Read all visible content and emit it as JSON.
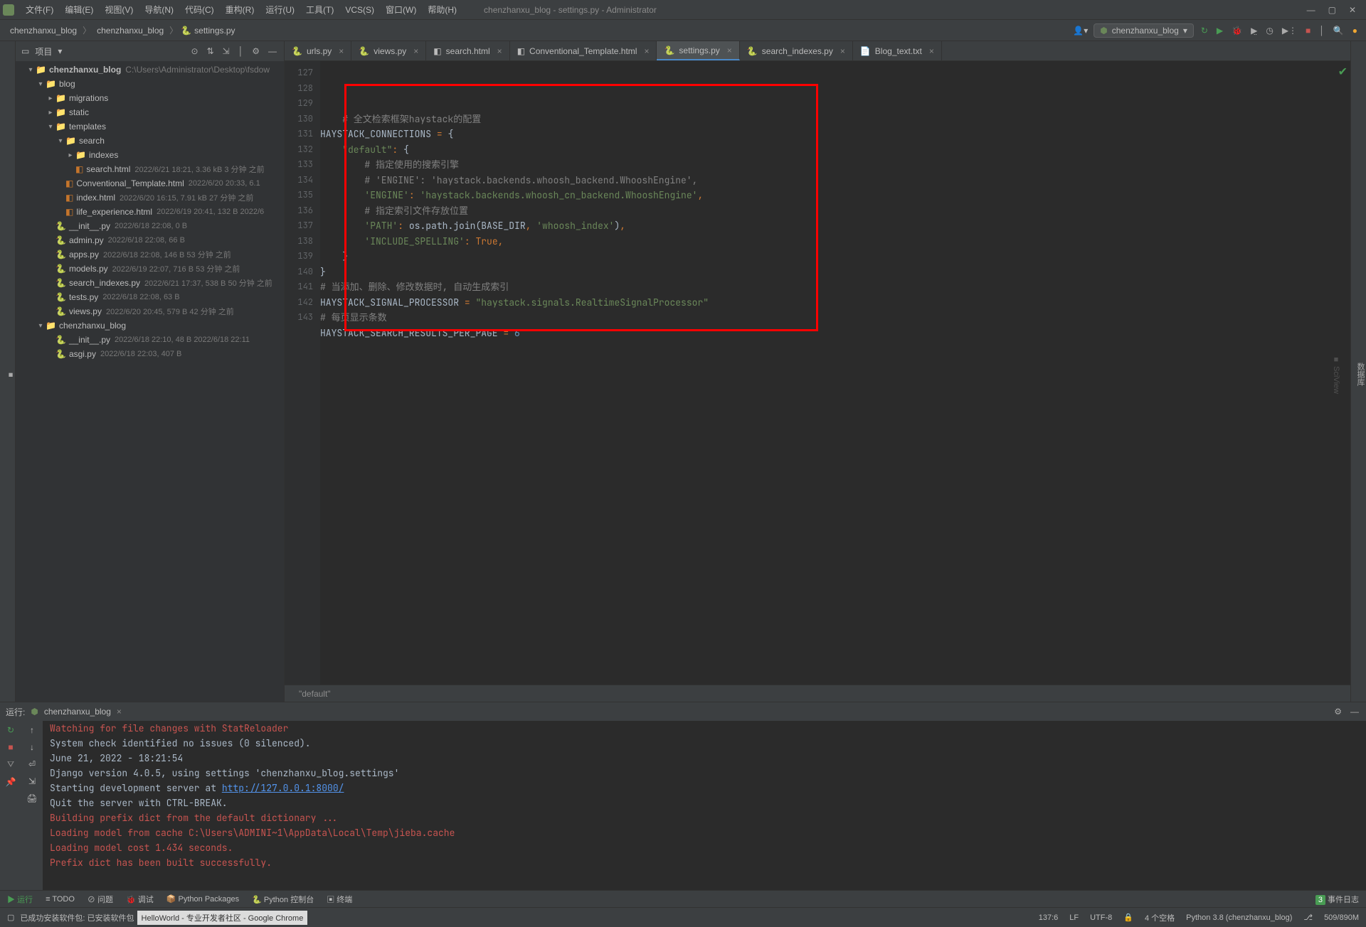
{
  "window": {
    "title": "chenzhanxu_blog - settings.py - Administrator"
  },
  "menubar": {
    "file": "文件(F)",
    "edit": "编辑(E)",
    "view": "视图(V)",
    "nav": "导航(N)",
    "code": "代码(C)",
    "refactor": "重构(R)",
    "run": "运行(U)",
    "tools": "工具(T)",
    "vcs": "VCS(S)",
    "window": "窗口(W)",
    "help": "帮助(H)"
  },
  "breadcrumbs": {
    "a": "chenzhanxu_blog",
    "b": "chenzhanxu_blog",
    "c": "settings.py"
  },
  "config": {
    "name": "chenzhanxu_blog"
  },
  "project": {
    "title": "项目",
    "root": "chenzhanxu_blog",
    "rootpath": "C:\\Users\\Administrator\\Desktop\\fsdow",
    "items": [
      {
        "i": 2,
        "caret": "▾",
        "icon": "F",
        "name": "blog"
      },
      {
        "i": 3,
        "caret": "▸",
        "icon": "F",
        "name": "migrations"
      },
      {
        "i": 3,
        "caret": "▸",
        "icon": "F",
        "name": "static"
      },
      {
        "i": 3,
        "caret": "▾",
        "icon": "F",
        "name": "templates"
      },
      {
        "i": 4,
        "caret": "▾",
        "icon": "F",
        "name": "search"
      },
      {
        "i": 5,
        "caret": "▸",
        "icon": "F",
        "name": "indexes"
      },
      {
        "i": 5,
        "caret": "",
        "icon": "H",
        "name": "search.html",
        "meta": "2022/6/21 18:21, 3.36 kB 3 分钟 之前"
      },
      {
        "i": 4,
        "caret": "",
        "icon": "H",
        "name": "Conventional_Template.html",
        "meta": "2022/6/20 20:33, 6.1"
      },
      {
        "i": 4,
        "caret": "",
        "icon": "H",
        "name": "index.html",
        "meta": "2022/6/20 16:15, 7.91 kB 27 分钟 之前"
      },
      {
        "i": 4,
        "caret": "",
        "icon": "H",
        "name": "life_experience.html",
        "meta": "2022/6/19 20:41, 132 B 2022/6"
      },
      {
        "i": 3,
        "caret": "",
        "icon": "P",
        "name": "__init__.py",
        "meta": "2022/6/18 22:08, 0 B"
      },
      {
        "i": 3,
        "caret": "",
        "icon": "P",
        "name": "admin.py",
        "meta": "2022/6/18 22:08, 66 B"
      },
      {
        "i": 3,
        "caret": "",
        "icon": "P",
        "name": "apps.py",
        "meta": "2022/6/18 22:08, 146 B 53 分钟 之前"
      },
      {
        "i": 3,
        "caret": "",
        "icon": "P",
        "name": "models.py",
        "meta": "2022/6/19 22:07, 716 B 53 分钟 之前"
      },
      {
        "i": 3,
        "caret": "",
        "icon": "P",
        "name": "search_indexes.py",
        "meta": "2022/6/21 17:37, 538 B 50 分钟 之前"
      },
      {
        "i": 3,
        "caret": "",
        "icon": "P",
        "name": "tests.py",
        "meta": "2022/6/18 22:08, 63 B"
      },
      {
        "i": 3,
        "caret": "",
        "icon": "P",
        "name": "views.py",
        "meta": "2022/6/20 20:45, 579 B 42 分钟 之前"
      },
      {
        "i": 2,
        "caret": "▾",
        "icon": "F",
        "name": "chenzhanxu_blog"
      },
      {
        "i": 3,
        "caret": "",
        "icon": "P",
        "name": "__init__.py",
        "meta": "2022/6/18 22:10, 48 B 2022/6/18 22:11"
      },
      {
        "i": 3,
        "caret": "",
        "icon": "P",
        "name": "asgi.py",
        "meta": "2022/6/18 22:03, 407 B"
      }
    ]
  },
  "tabs": [
    {
      "name": "urls.py",
      "icon": "P"
    },
    {
      "name": "views.py",
      "icon": "P"
    },
    {
      "name": "search.html",
      "icon": "H"
    },
    {
      "name": "Conventional_Template.html",
      "icon": "H"
    },
    {
      "name": "settings.py",
      "icon": "P",
      "active": true
    },
    {
      "name": "search_indexes.py",
      "icon": "P"
    },
    {
      "name": "Blog_text.txt",
      "icon": "T"
    }
  ],
  "code": {
    "start": 127,
    "lines": [
      {
        "t": ""
      },
      {
        "t": "    # 全文检索框架haystack的配置",
        "cls": "c-comment"
      },
      {
        "html": "<span class='c-var'>HAYSTACK_CONNECTIONS </span><span class='c-op'>=</span><span class='c-var'> </span><span class='c-brace'>{</span>"
      },
      {
        "html": "    <span class='c-str'>\"default\"</span><span class='c-op'>:</span> <span class='c-brace'>{</span>"
      },
      {
        "html": "        <span class='c-comment'># 指定使用的搜索引擎</span>"
      },
      {
        "html": "        <span class='c-comment'># 'ENGINE': 'haystack.backends.whoosh_backend.WhooshEngine',</span>"
      },
      {
        "html": "        <span class='c-str'>'ENGINE'</span><span class='c-op'>:</span> <span class='c-str'>'haystack.backends.whoosh_cn_backend.WhooshEngine'</span><span class='c-op'>,</span>"
      },
      {
        "html": "        <span class='c-comment'># 指定索引文件存放位置</span>"
      },
      {
        "html": "        <span class='c-str'>'PATH'</span><span class='c-op'>:</span> <span class='c-var'>os.path.join(BASE_DIR</span><span class='c-op'>,</span> <span class='c-str'>'whoosh_index'</span><span class='c-var'>)</span><span class='c-op'>,</span>"
      },
      {
        "html": "        <span class='c-str'>'INCLUDE_SPELLING'</span><span class='c-op'>:</span> <span class='c-kw'>True</span><span class='c-op'>,</span>"
      },
      {
        "html": "    <span class='c-brace'>}</span>"
      },
      {
        "html": "<span class='c-brace'>}</span>"
      },
      {
        "html": "<span class='c-comment'># 当添加、删除、修改数据时, 自动生成索引</span>"
      },
      {
        "html": "<span class='c-var'>HAYSTACK_SIGNAL_PROCESSOR </span><span class='c-op'>=</span> <span class='c-str'>\"haystack.signals.RealtimeSignalProcessor\"</span>"
      },
      {
        "html": "<span class='c-comment'># 每页显示条数</span>"
      },
      {
        "html": "<span class='c-var'>HAYSTACK_SEARCH_RESULTS_PER_PAGE </span><span class='c-op'>=</span> <span class='c-num'>6</span>"
      },
      {
        "t": ""
      }
    ],
    "bc": "\"default\""
  },
  "run": {
    "label": "运行:",
    "tab": "chenzhanxu_blog",
    "lines": [
      {
        "t": "",
        "cls": "con-white"
      },
      {
        "t": "Watching for file changes with StatReloader",
        "cls": "con-red"
      },
      {
        "t": "System check identified no issues (0 silenced).",
        "cls": "con-white"
      },
      {
        "t": "June 21, 2022 - 18:21:54",
        "cls": "con-white"
      },
      {
        "t": "Django version 4.0.5, using settings 'chenzhanxu_blog.settings'",
        "cls": "con-white"
      },
      {
        "t": "Starting development server at ",
        "cls": "con-white",
        "link": "http://127.0.0.1:8000/"
      },
      {
        "t": "Quit the server with CTRL-BREAK.",
        "cls": "con-white"
      },
      {
        "t": "Building prefix dict from the default dictionary ...",
        "cls": "con-red"
      },
      {
        "t": "Loading model from cache C:\\Users\\ADMINI~1\\AppData\\Local\\Temp\\jieba.cache",
        "cls": "con-red"
      },
      {
        "t": "Loading model cost 1.434 seconds.",
        "cls": "con-red"
      },
      {
        "t": "Prefix dict has been built successfully.",
        "cls": "con-red"
      }
    ]
  },
  "bottombar": {
    "run": "运行",
    "todo": "TODO",
    "problems": "问题",
    "debug": "调试",
    "pypkg": "Python Packages",
    "pycon": "Python 控制台",
    "terminal": "终端",
    "events": "事件日志",
    "eventcount": "3"
  },
  "statusbar": {
    "msg": "已成功安装软件包: 已安装软件包",
    "chrome": "HelloWorld - 专业开发者社区 - Google Chrome",
    "pos": "137:6",
    "lf": "LF",
    "enc": "UTF-8",
    "indent": "4 个空格",
    "interp": "Python 3.8 (chenzhanxu_blog)",
    "mem": "509/890M"
  }
}
